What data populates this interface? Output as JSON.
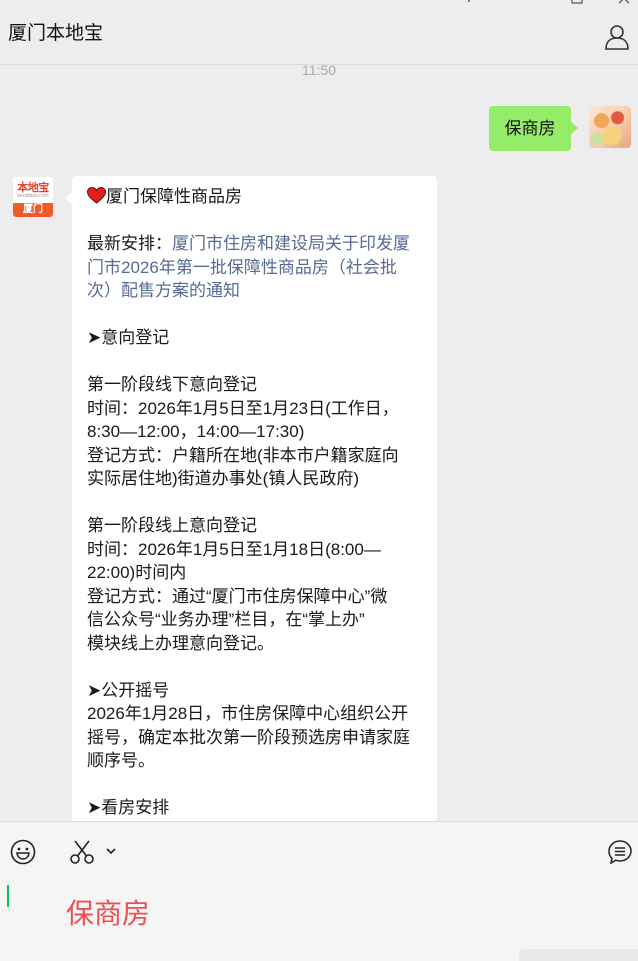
{
  "header": {
    "title": "厦门本地宝"
  },
  "chat": {
    "timestamp": "11:50",
    "outgoing_message": "保商房",
    "incoming": {
      "avatar": {
        "logo_top": "本地宝",
        "logo_url": "bendibao.com",
        "logo_bottom": "厦门"
      },
      "title": "厦门保障性商品房",
      "latest_prefix": "最新安排：",
      "latest_link_lines": [
        "厦门市住房和建设局关于印发厦",
        "门市2026年第一批保障性商品房（社会批",
        "次）配售方案的通知"
      ],
      "body_lines": [
        "",
        "➤意向登记",
        "",
        "第一阶段线下意向登记",
        "时间：2026年1月5日至1月23日(工作日，",
        "8:30—12:00，14:00—17:30)",
        "登记方式：户籍所在地(非本市户籍家庭向",
        "实际居住地)街道办事处(镇人民政府)",
        "",
        "第一阶段线上意向登记",
        "时间：2026年1月5日至1月18日(8:00—",
        "22:00)时间内",
        "登记方式：通过“厦门市住房保障中心”微",
        "信公众号“业务办理”栏目，在“掌上办”",
        "模块线上办理意向登记。",
        "",
        "➤公开摇号",
        "2026年1月28日，市住房保障中心组织公开",
        "摇号，确定本批次第一阶段预选房申请家庭",
        "顺序号。",
        "",
        "➤看房安排"
      ]
    }
  },
  "input": {
    "text": "保商房"
  },
  "icons": {
    "emoji": "emoji-icon",
    "screenshot": "scissors-icon",
    "dropdown": "chevron-down-icon",
    "history": "chat-history-icon",
    "profile": "person-icon"
  },
  "colors": {
    "outgoing_bubble": "#95ec69",
    "link": "#576b95",
    "input_text": "#f04e4e",
    "caret": "#07c160"
  }
}
